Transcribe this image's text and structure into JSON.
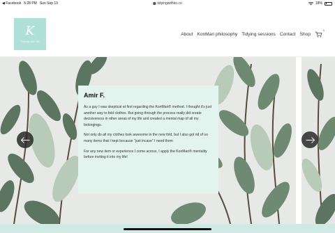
{
  "status_bar": {
    "back_app": "◀ Facebook",
    "time": "5:28 PM",
    "date": "Sun Sep 19",
    "url": "tidyingwithko.co",
    "battery": "18%",
    "battery_level": 0.18
  },
  "logo": {
    "mark": "K",
    "text": "Tidying with Ko"
  },
  "nav": {
    "items": [
      "About",
      "KonMari philosophy",
      "Tidying sessions",
      "Contact",
      "Shop"
    ],
    "cart_count": "0"
  },
  "testimonial": {
    "name": "Amir F.",
    "paragraphs": [
      "As a guy I was skeptical at first regarding the KonMari® method. I thought it's just another way to fold clothes. But going through the process really did create decisiveness in other areas of my life and created a mental map of all my belongings.",
      "Not only do all my clothes look awesome in the new fold, but I also got rid of so many items that I kept because \"just incase\" I need them",
      "For any new item or experience I come across, I apply the KonMari® mentality before inviting it into my life!"
    ]
  },
  "carousel": {
    "prev_icon": "arrow-left-icon",
    "next_icon": "arrow-right-icon"
  },
  "colors": {
    "brand": "#aee0d7",
    "card_bg": "#e3f3ee",
    "footer_strip": "#cfe9e3"
  }
}
